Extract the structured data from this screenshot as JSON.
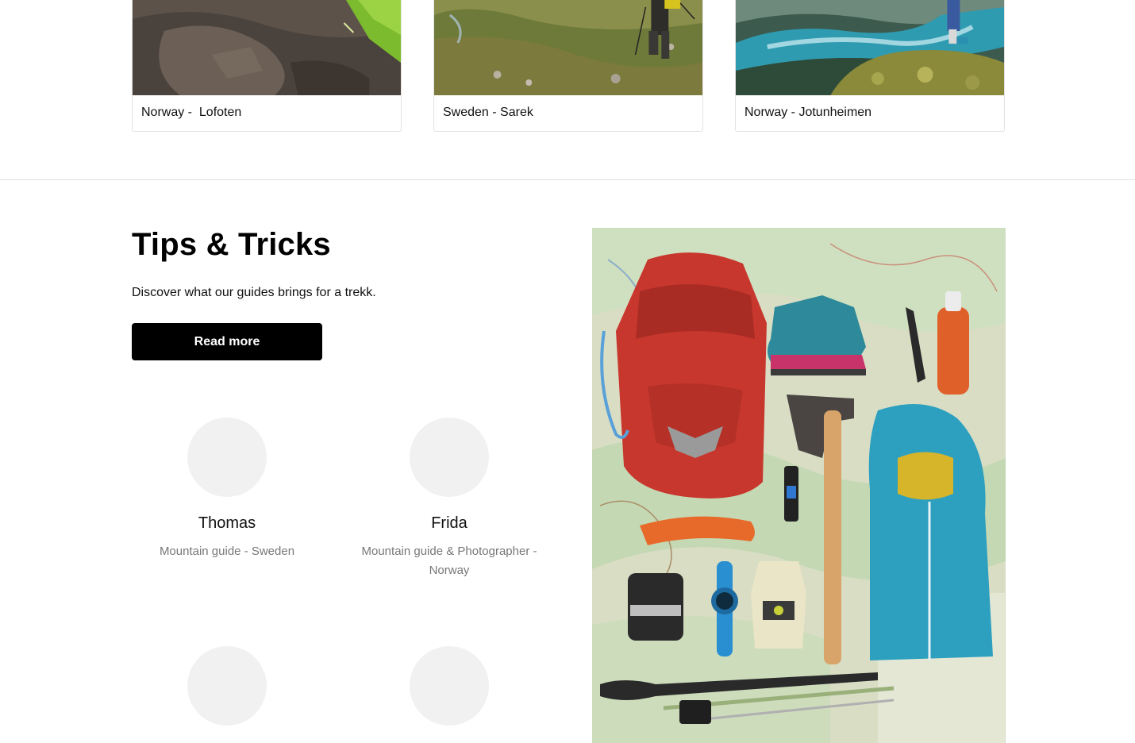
{
  "destinations": [
    {
      "caption": "Norway -  Lofoten",
      "photo": "tent-on-rock-photo"
    },
    {
      "caption": "Sweden - Sarek",
      "photo": "hiker-in-valley-photo"
    },
    {
      "caption": "Norway - Jotunheimen",
      "photo": "lake-overlook-photo"
    }
  ],
  "tips": {
    "title": "Tips & Tricks",
    "description": "Discover what our guides brings for a trekk.",
    "button_label": "Read more",
    "photo": "hiking-gear-flatlay-photo"
  },
  "guides": [
    {
      "name": "Thomas",
      "role": "Mountain guide - Sweden"
    },
    {
      "name": "Frida",
      "role": "Mountain guide & Photographer - Norway"
    },
    {
      "name": "",
      "role": ""
    },
    {
      "name": "",
      "role": ""
    }
  ],
  "colors": {
    "button_bg": "#000000",
    "button_text": "#ffffff",
    "avatar_bg": "#f1f1f1",
    "muted_text": "#777777"
  }
}
